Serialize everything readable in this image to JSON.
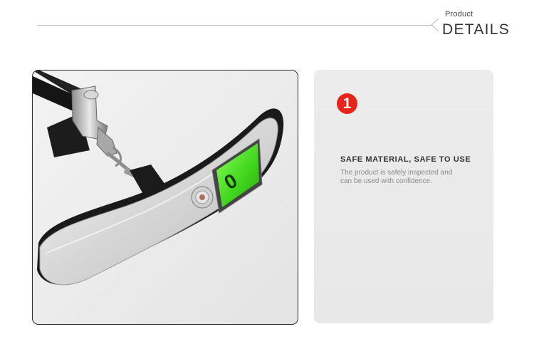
{
  "header": {
    "small_label": "Product",
    "big_label": "DETAILS"
  },
  "product_image": {
    "display_reading": "0"
  },
  "feature": {
    "number": "1",
    "title": "SAFE MATERIAL, SAFE TO USE",
    "description": "The product is safely inspected and\n can be used with confidence."
  },
  "colors": {
    "badge": "#e8231a",
    "lcd_backlight": "#3fd41c"
  }
}
